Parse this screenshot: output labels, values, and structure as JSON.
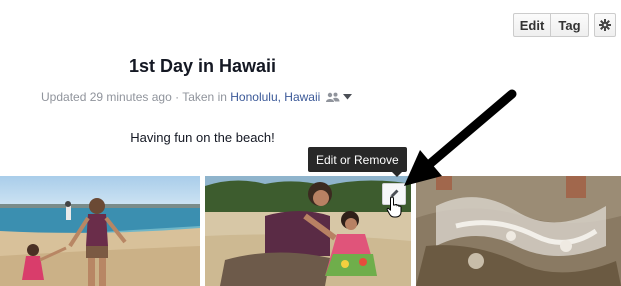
{
  "toolbar": {
    "edit_label": "Edit",
    "tag_label": "Tag",
    "gear_icon": "gear-icon"
  },
  "album": {
    "title": "1st Day in Hawaii",
    "meta_updated": "Updated 29 minutes ago",
    "meta_sep": " · Taken in ",
    "location": "Honolulu, Hawaii",
    "privacy_icon": "friends-icon",
    "description": "Having fun on the beach!"
  },
  "tooltip": {
    "text": "Edit or Remove"
  },
  "photos": [
    {
      "name": "beach-mother-daughter-walking"
    },
    {
      "name": "beach-mother-daughter-posing"
    },
    {
      "name": "water-splash"
    }
  ],
  "colors": {
    "link": "#3b5998",
    "muted": "#90949c",
    "tooltip_bg": "#282828"
  }
}
